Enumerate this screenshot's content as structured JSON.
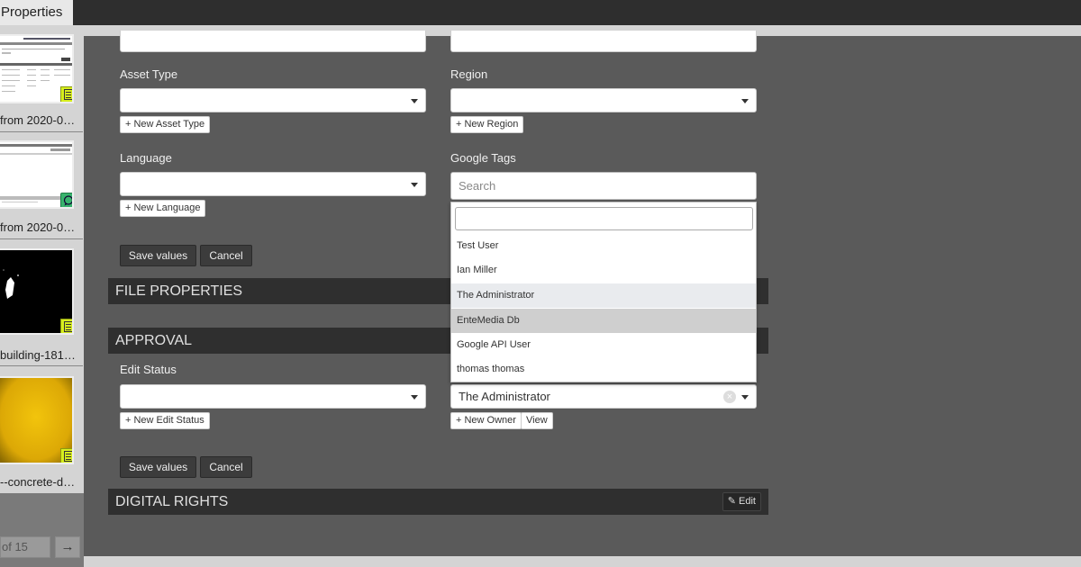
{
  "header": {
    "tab_label": "Properties"
  },
  "sidebar": {
    "items": [
      {
        "label": "from 2020-0…",
        "badge": "document-icon"
      },
      {
        "label": "from 2020-0…",
        "badge": "chat-icon"
      },
      {
        "label": "building-181…",
        "badge": "document-icon"
      },
      {
        "label": "--concrete-d…",
        "badge": "document-icon"
      }
    ],
    "pager": {
      "text": "of 15"
    }
  },
  "form": {
    "asset_type": {
      "label": "Asset Type",
      "new_label": "+ New Asset Type"
    },
    "region": {
      "label": "Region",
      "new_label": "+ New Region"
    },
    "language": {
      "label": "Language",
      "new_label": "+ New Language"
    },
    "google_tags": {
      "label": "Google Tags",
      "placeholder": "Search"
    },
    "save_label": "Save values",
    "cancel_label": "Cancel"
  },
  "sections": {
    "file_properties": "FILE PROPERTIES",
    "approval": "APPROVAL",
    "digital_rights": "DIGITAL RIGHTS",
    "edit_label": "Edit"
  },
  "approval": {
    "edit_status": {
      "label": "Edit Status",
      "new_label": "+ New Edit Status"
    },
    "owner": {
      "value": "The Administrator",
      "new_label": "+ New Owner",
      "view_label": "View"
    },
    "save_label": "Save values",
    "cancel_label": "Cancel"
  },
  "dropdown": {
    "options": [
      "Test User",
      "Ian Miller",
      "The Administrator",
      "EnteMedia Db",
      "Google API User",
      "thomas thomas"
    ]
  }
}
